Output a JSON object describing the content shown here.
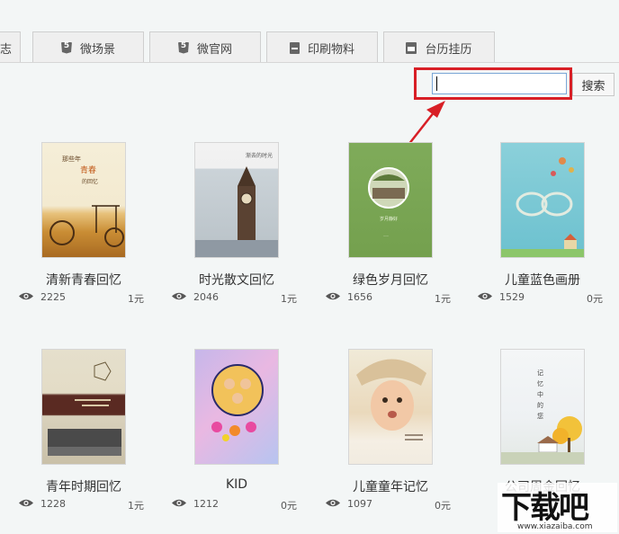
{
  "tabs": [
    {
      "label": "志",
      "icon": "none"
    },
    {
      "label": "微场景",
      "icon": "html5-icon"
    },
    {
      "label": "微官网",
      "icon": "html5-icon"
    },
    {
      "label": "印刷物料",
      "icon": "document-icon"
    },
    {
      "label": "台历挂历",
      "icon": "calendar-icon"
    }
  ],
  "search": {
    "placeholder": "",
    "value": "",
    "button_label": "搜索"
  },
  "colors": {
    "highlight": "#d81f26",
    "page_background": "#f3f6f6"
  },
  "templates": [
    {
      "title": "清新青春回忆",
      "views": "2225",
      "price": "1元",
      "cover_text": "那些年\n青春\n的回忆"
    },
    {
      "title": "时光散文回忆",
      "views": "2046",
      "price": "1元",
      "cover_text": "渐去的时光"
    },
    {
      "title": "绿色岁月回忆",
      "views": "1656",
      "price": "1元",
      "cover_text": "岁月静好"
    },
    {
      "title": "儿童蓝色画册",
      "views": "1529",
      "price": "0元",
      "cover_text": ""
    },
    {
      "title": "青年时期回忆",
      "views": "1228",
      "price": "1元",
      "cover_text": ""
    },
    {
      "title": "KID",
      "views": "1212",
      "price": "0元",
      "cover_text": ""
    },
    {
      "title": "儿童童年记忆",
      "views": "1097",
      "price": "0元",
      "cover_text": ""
    },
    {
      "title": "公司周金回忆",
      "views": "",
      "price": "",
      "cover_text": "记\n忆\n中\n的\n您"
    }
  ],
  "watermark": {
    "text": "下载吧",
    "url": "www.xiazaiba.com"
  }
}
